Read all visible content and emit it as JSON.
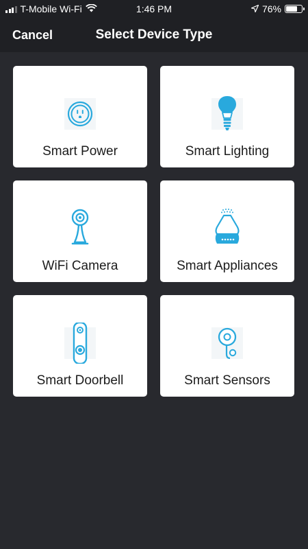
{
  "status": {
    "carrier": "T-Mobile Wi-Fi",
    "time": "1:46 PM",
    "battery_percent": "76%",
    "battery_level": 0.76,
    "signal_bars": 3
  },
  "nav": {
    "cancel_label": "Cancel",
    "title": "Select Device Type"
  },
  "accent_color": "#29a9dd",
  "devices": [
    {
      "label": "Smart Power",
      "icon": "smart-plug-icon"
    },
    {
      "label": "Smart Lighting",
      "icon": "light-bulb-icon"
    },
    {
      "label": "WiFi Camera",
      "icon": "camera-icon"
    },
    {
      "label": "Smart Appliances",
      "icon": "diffuser-icon"
    },
    {
      "label": "Smart Doorbell",
      "icon": "doorbell-icon"
    },
    {
      "label": "Smart Sensors",
      "icon": "sensor-icon"
    }
  ]
}
